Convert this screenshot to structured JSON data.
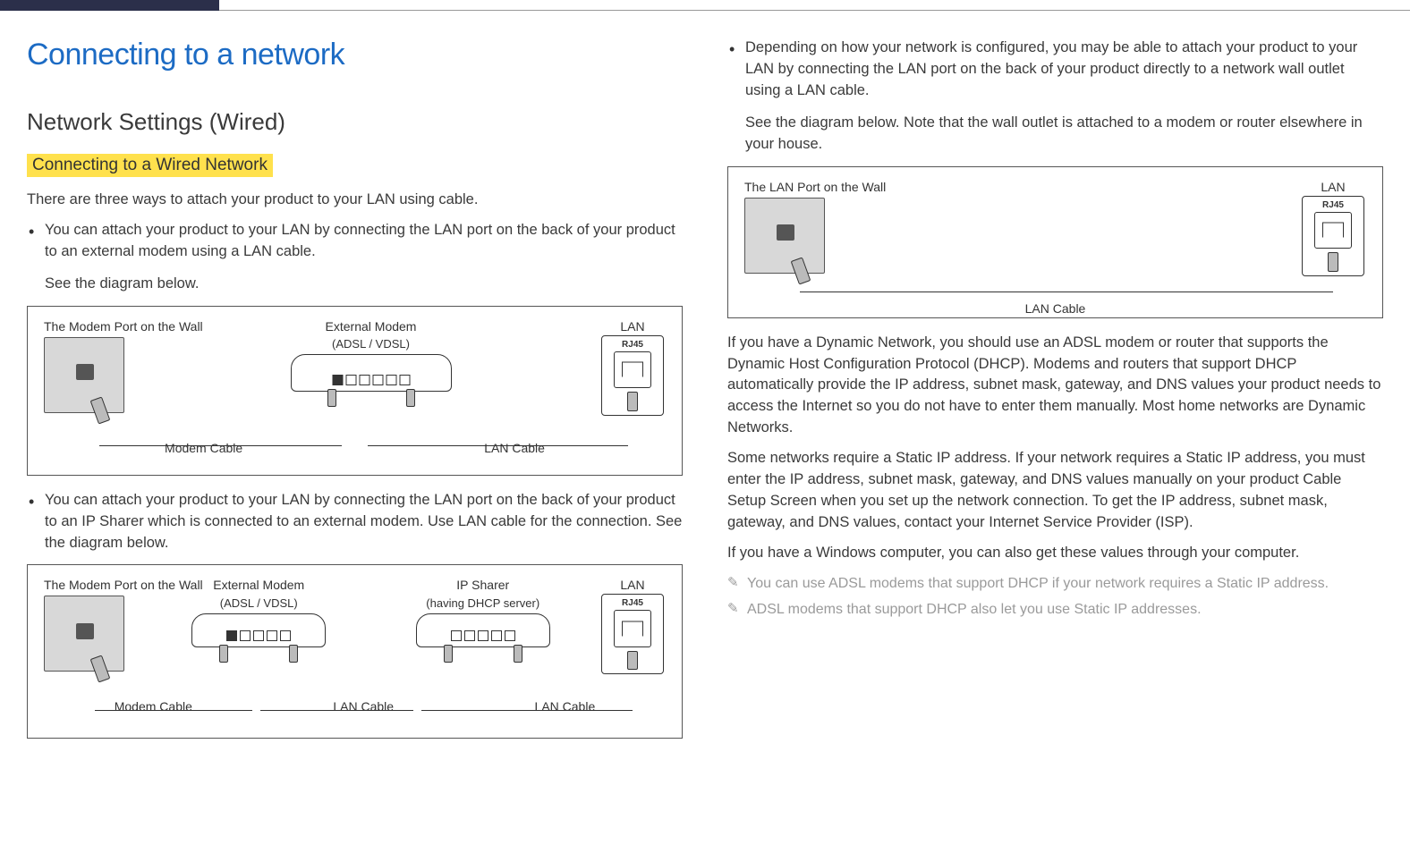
{
  "title": "Connecting to a network",
  "section": "Network Settings (Wired)",
  "subsection": "Connecting to a Wired Network",
  "intro": "There are three ways to attach your product to your LAN using cable.",
  "bullet1_main": "You can attach your product to your LAN by connecting the LAN port on the back of your product to an external modem using a LAN cable.",
  "bullet1_sub": "See the diagram below.",
  "diagram1": {
    "wall_label": "The Modem Port on the Wall",
    "modem_label": "External Modem",
    "modem_sub": "(ADSL / VDSL)",
    "lan_title": "LAN",
    "rj45": "RJ45",
    "cable_left": "Modem Cable",
    "cable_right": "LAN Cable"
  },
  "bullet2_main": "You can attach your product to your LAN by connecting the LAN port on the back of your product to an IP Sharer which is connected to an external modem. Use LAN cable for the connection. See the diagram below.",
  "diagram2": {
    "wall_label": "The Modem Port on the Wall",
    "modem_label": "External Modem",
    "modem_sub": "(ADSL / VDSL)",
    "sharer_label": "IP Sharer",
    "sharer_sub": "(having DHCP server)",
    "lan_title": "LAN",
    "rj45": "RJ45",
    "cable_1": "Modem Cable",
    "cable_2": "LAN Cable",
    "cable_3": "LAN Cable"
  },
  "bullet3_main": "Depending on how your network is configured, you may be able to attach your product to your LAN by connecting the LAN port on the back of your product directly to a network wall outlet using a LAN cable.",
  "bullet3_sub": "See the diagram below. Note that the wall outlet is attached to a modem or router elsewhere in your house.",
  "diagram3": {
    "wall_label": "The LAN Port on the Wall",
    "lan_title": "LAN",
    "rj45": "RJ45",
    "cable": "LAN Cable"
  },
  "para_dynamic": "If you have a Dynamic Network, you should use an ADSL modem or router that supports the Dynamic Host Configuration Protocol (DHCP). Modems and routers that support DHCP automatically provide the IP address, subnet mask, gateway, and DNS values your product needs to access the Internet so you do not have to enter them manually. Most home networks are Dynamic Networks.",
  "para_static": "Some networks require a Static IP address. If your network requires a Static IP address, you must enter the IP address, subnet mask, gateway, and DNS values manually on your product Cable Setup Screen when you set up the network connection. To get the IP address, subnet mask, gateway, and DNS values, contact your Internet Service Provider (ISP).",
  "para_windows": "If you have a Windows computer, you can also get these values through your computer.",
  "note1": "You can use ADSL modems that support DHCP if your network requires a Static IP address.",
  "note2": "ADSL modems that support DHCP also let you use Static IP addresses."
}
